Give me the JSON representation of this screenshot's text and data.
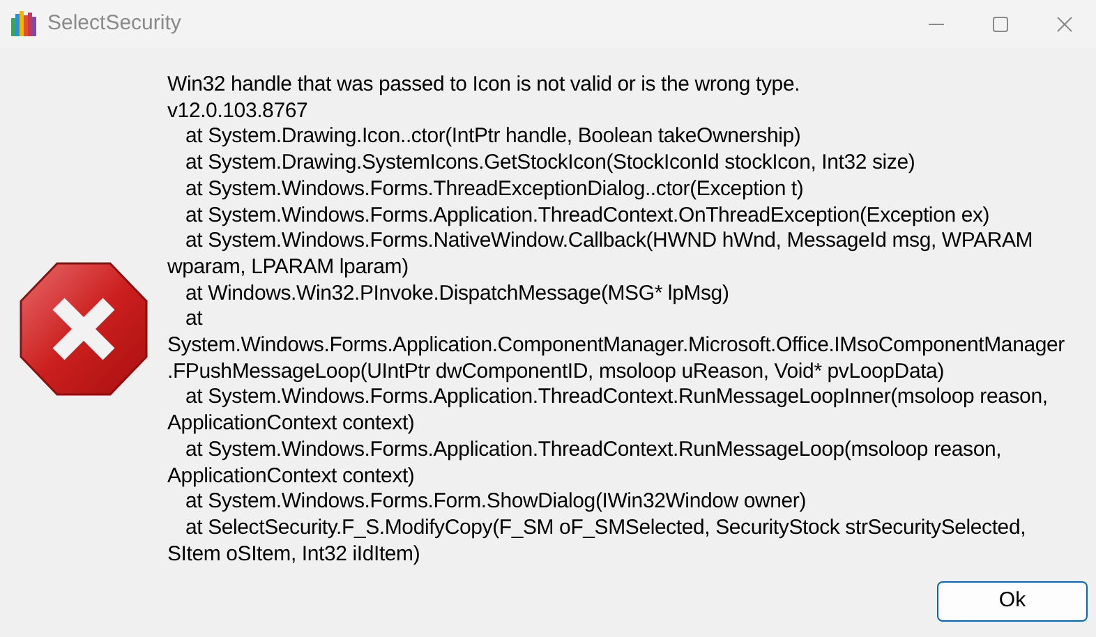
{
  "window": {
    "title": "SelectSecurity"
  },
  "message": {
    "lines": [
      {
        "text": "Win32 handle that was passed to Icon is not valid or is the wrong type.",
        "indented": false
      },
      {
        "text": "v12.0.103.8767",
        "indented": false
      },
      {
        "text": "at System.Drawing.Icon..ctor(IntPtr handle, Boolean takeOwnership)",
        "indented": true
      },
      {
        "text": "at System.Drawing.SystemIcons.GetStockIcon(StockIconId stockIcon, Int32 size)",
        "indented": true
      },
      {
        "text": "at System.Windows.Forms.ThreadExceptionDialog..ctor(Exception t)",
        "indented": true
      },
      {
        "text": "at System.Windows.Forms.Application.ThreadContext.OnThreadException(Exception ex)",
        "indented": true
      },
      {
        "text": "at System.Windows.Forms.NativeWindow.Callback(HWND hWnd, MessageId msg, WPARAM",
        "indented": true
      },
      {
        "text": "wparam, LPARAM lparam)",
        "indented": false
      },
      {
        "text": "at Windows.Win32.PInvoke.DispatchMessage(MSG* lpMsg)",
        "indented": true
      },
      {
        "text": "at",
        "indented": true
      },
      {
        "text": "System.Windows.Forms.Application.ComponentManager.Microsoft.Office.IMsoComponentManager",
        "indented": false
      },
      {
        "text": ".FPushMessageLoop(UIntPtr dwComponentID, msoloop uReason, Void* pvLoopData)",
        "indented": false
      },
      {
        "text": "at System.Windows.Forms.Application.ThreadContext.RunMessageLoopInner(msoloop reason,",
        "indented": true
      },
      {
        "text": "ApplicationContext context)",
        "indented": false
      },
      {
        "text": "at System.Windows.Forms.Application.ThreadContext.RunMessageLoop(msoloop reason,",
        "indented": true
      },
      {
        "text": "ApplicationContext context)",
        "indented": false
      },
      {
        "text": "at System.Windows.Forms.Form.ShowDialog(IWin32Window owner)",
        "indented": true
      },
      {
        "text": "at SelectSecurity.F_S.ModifyCopy(F_SM oF_SMSelected, SecurityStock strSecuritySelected,",
        "indented": true
      },
      {
        "text": "SItem oSItem, Int32 iIdItem)",
        "indented": false
      }
    ]
  },
  "buttons": [
    {
      "label": "Ok"
    }
  ]
}
